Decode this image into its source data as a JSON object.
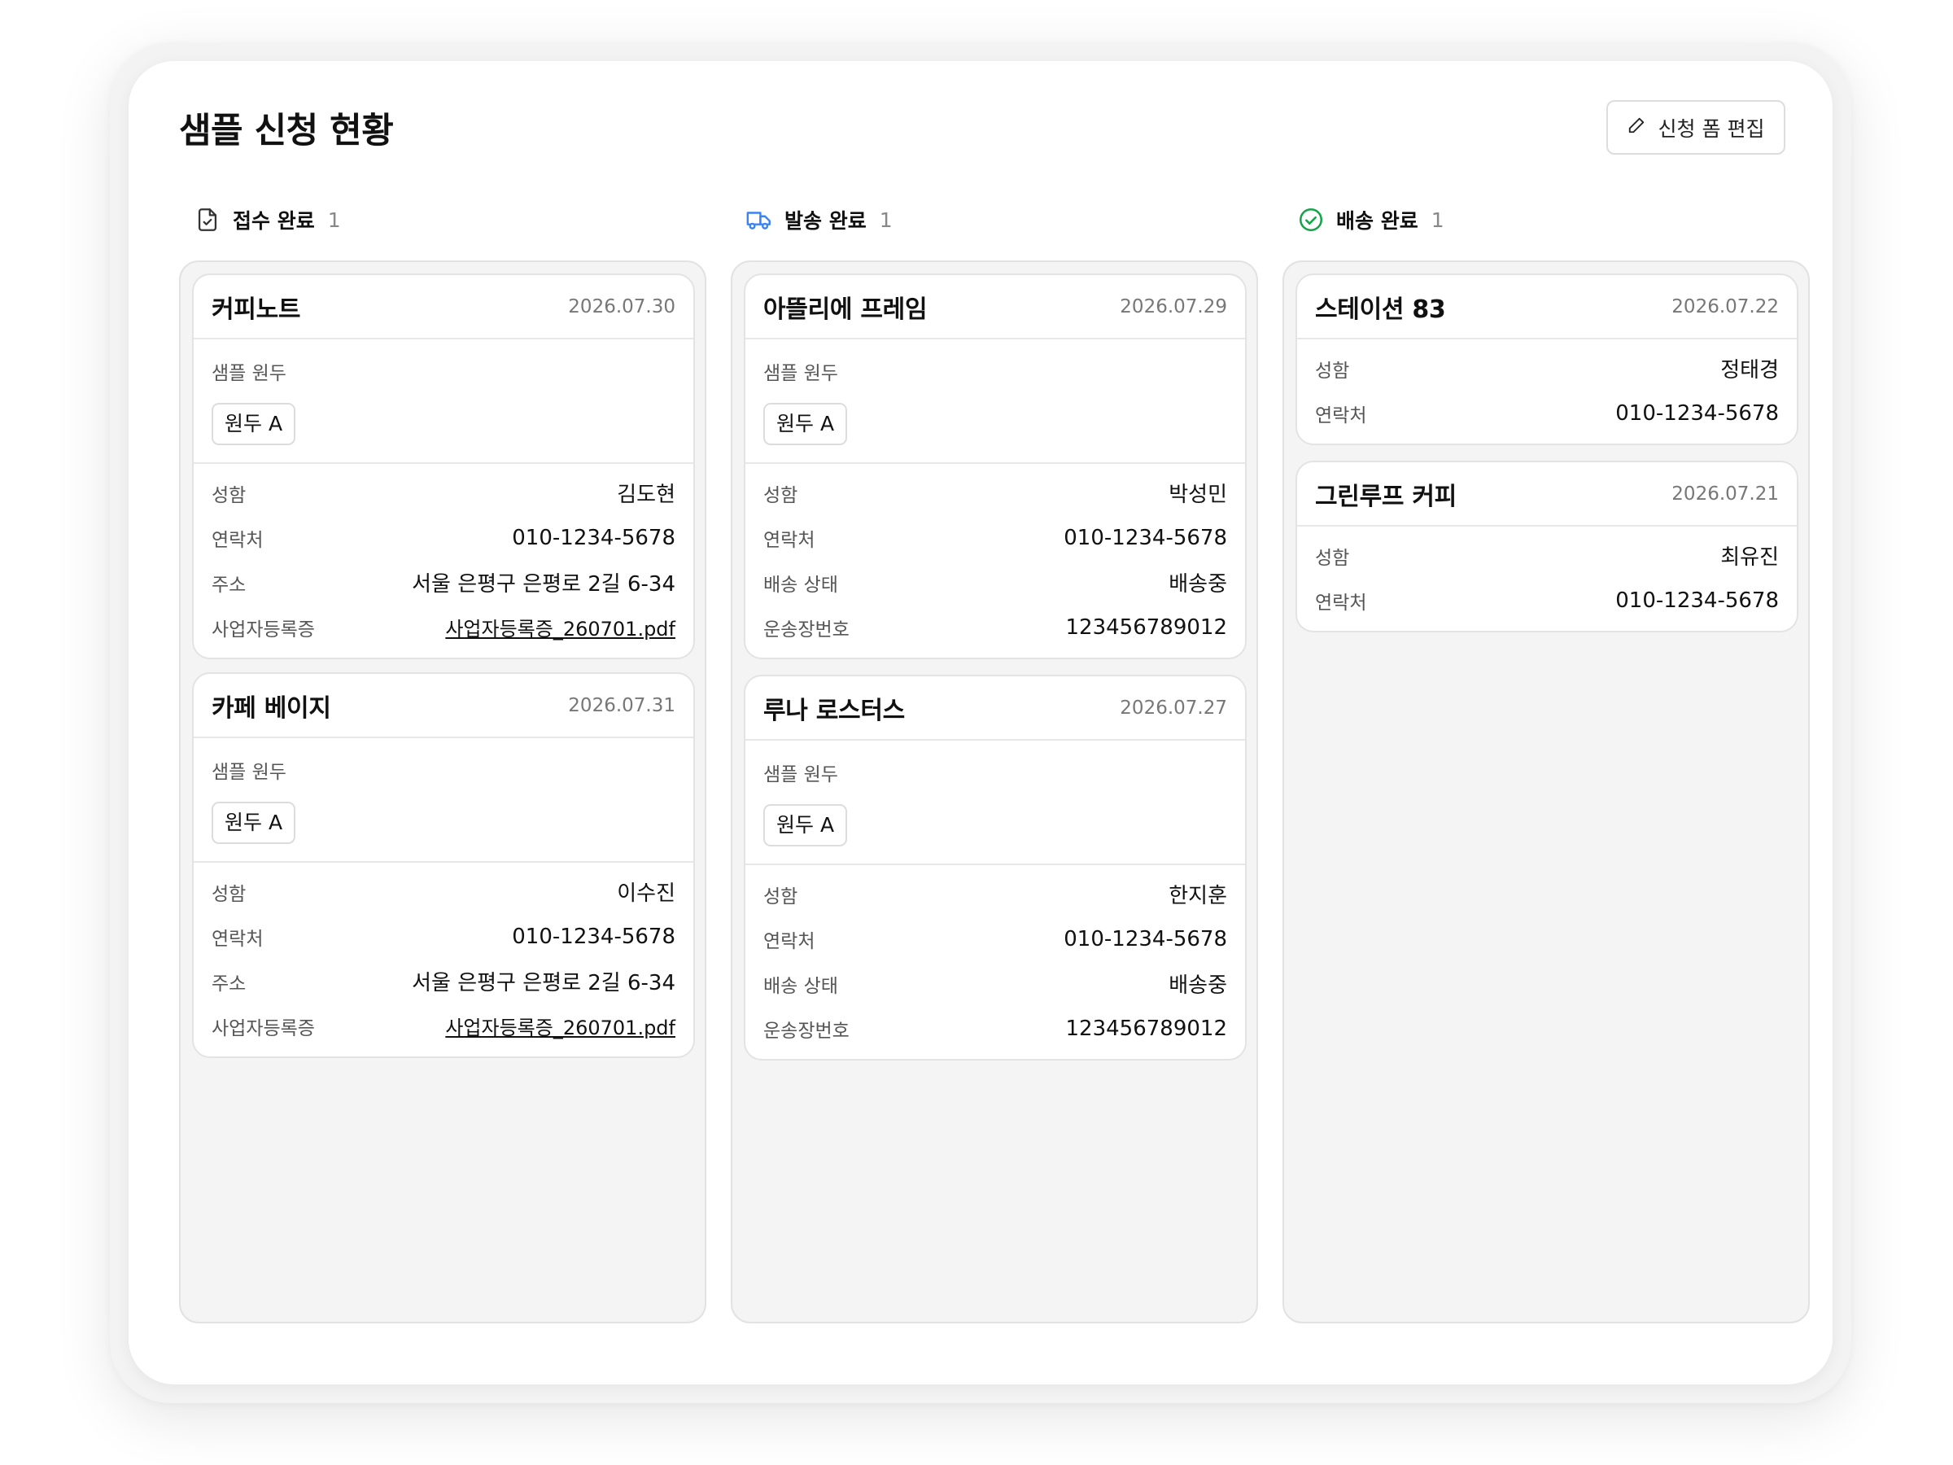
{
  "header": {
    "title": "샘플 신청 현황",
    "edit_button": "신청 폼 편집"
  },
  "colors": {
    "truck_icon": "#3b82f6",
    "check_icon": "#16a34a",
    "column_bg": "#f4f4f4"
  },
  "columns": [
    {
      "label": "접수 완료",
      "count": "1",
      "icon": "document-check-icon",
      "cards": [
        {
          "name": "커피노트",
          "date": "2026.07.30",
          "sample_label": "샘플 원두",
          "sample": "원두 A",
          "rows": [
            {
              "key": "성함",
              "value": "김도현"
            },
            {
              "key": "연락처",
              "value": "010-1234-5678"
            },
            {
              "key": "주소",
              "value": "서울 은평구 은평로 2길 6-34"
            },
            {
              "key": "사업자등록증",
              "value": "사업자등록증_260701.pdf"
            }
          ]
        },
        {
          "name": "카페 베이지",
          "date": "2026.07.31",
          "sample_label": "샘플 원두",
          "sample": "원두 A",
          "rows": [
            {
              "key": "성함",
              "value": "이수진"
            },
            {
              "key": "연락처",
              "value": "010-1234-5678"
            },
            {
              "key": "주소",
              "value": "서울 은평구 은평로 2길 6-34"
            },
            {
              "key": "사업자등록증",
              "value": "사업자등록증_260701.pdf"
            }
          ]
        }
      ]
    },
    {
      "label": "발송 완료",
      "count": "1",
      "icon": "truck-icon",
      "cards": [
        {
          "name": "아뜰리에 프레임",
          "date": "2026.07.29",
          "sample_label": "샘플 원두",
          "sample": "원두 A",
          "rows": [
            {
              "key": "성함",
              "value": "박성민"
            },
            {
              "key": "연락처",
              "value": "010-1234-5678"
            },
            {
              "key": "배송 상태",
              "value": "배송중"
            },
            {
              "key": "운송장번호",
              "value": "123456789012"
            }
          ]
        },
        {
          "name": "루나 로스터스",
          "date": "2026.07.27",
          "sample_label": "샘플 원두",
          "sample": "원두 A",
          "rows": [
            {
              "key": "성함",
              "value": "한지훈"
            },
            {
              "key": "연락처",
              "value": "010-1234-5678"
            },
            {
              "key": "배송 상태",
              "value": "배송중"
            },
            {
              "key": "운송장번호",
              "value": "123456789012"
            }
          ]
        }
      ]
    },
    {
      "label": "배송 완료",
      "count": "1",
      "icon": "check-circle-icon",
      "cards": [
        {
          "name": "스테이션 83",
          "date": "2026.07.22",
          "rows": [
            {
              "key": "성함",
              "value": "정태경"
            },
            {
              "key": "연락처",
              "value": "010-1234-5678"
            }
          ]
        },
        {
          "name": "그린루프 커피",
          "date": "2026.07.21",
          "rows": [
            {
              "key": "성함",
              "value": "최유진"
            },
            {
              "key": "연락처",
              "value": "010-1234-5678"
            }
          ]
        }
      ]
    }
  ]
}
